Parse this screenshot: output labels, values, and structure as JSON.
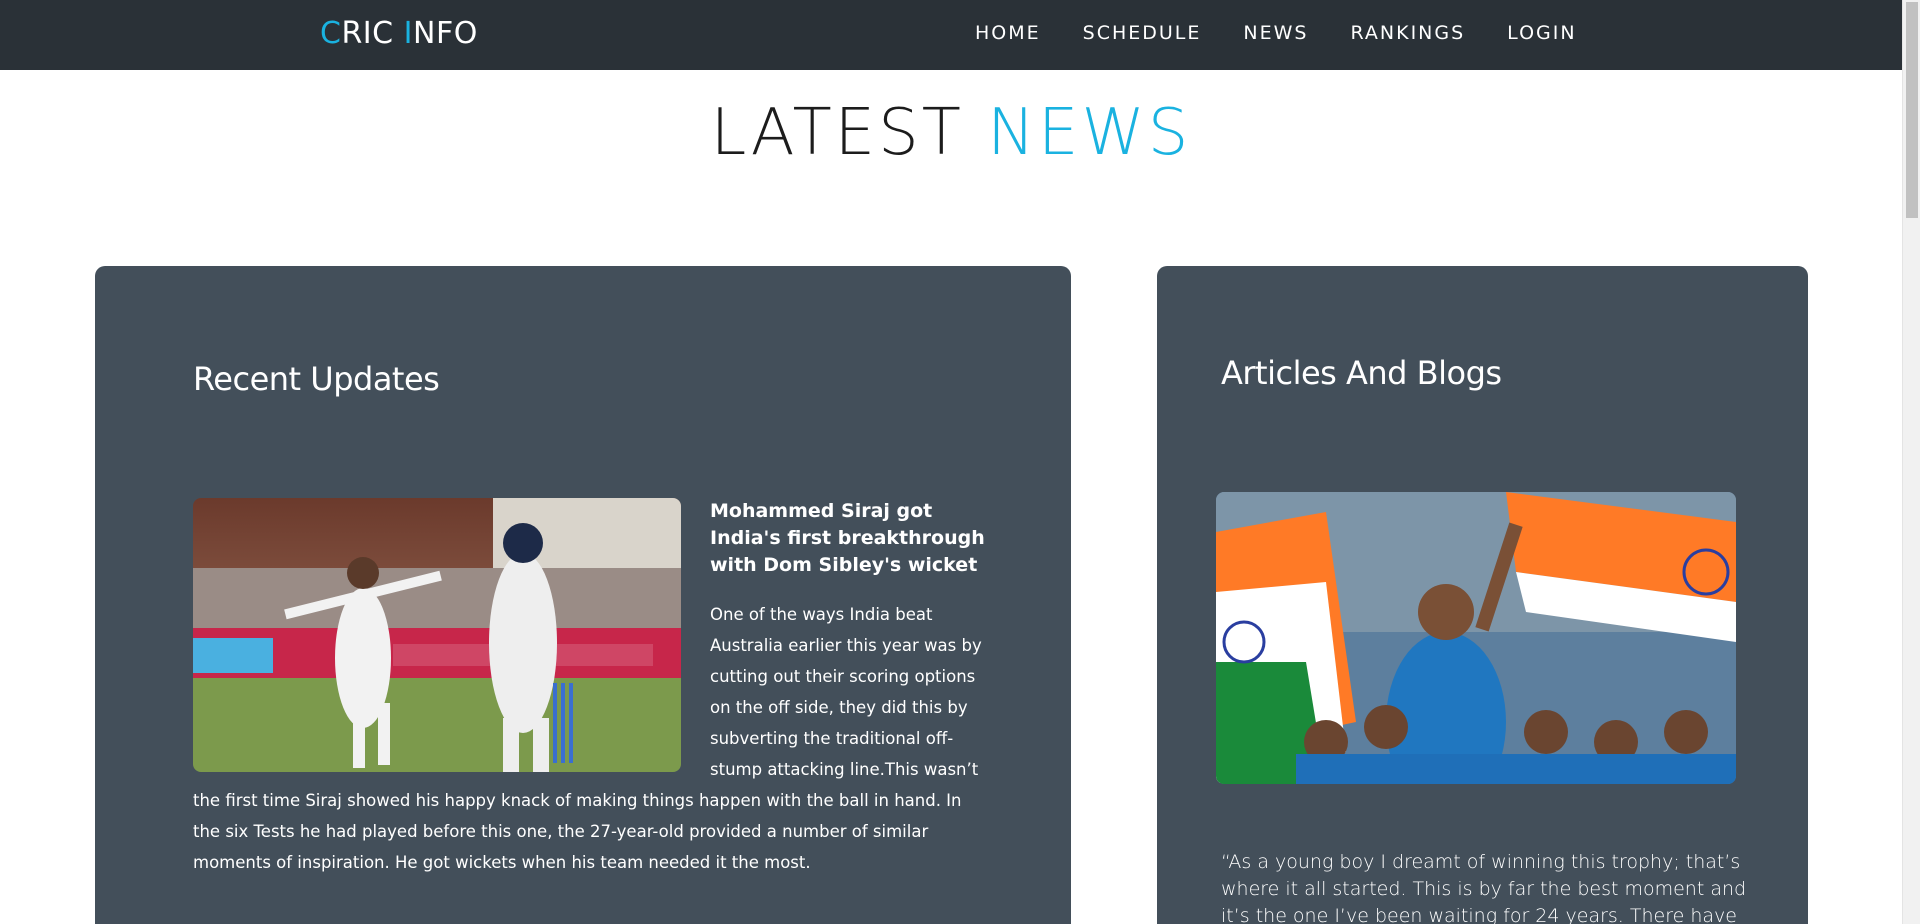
{
  "brand": {
    "first_letter": "C",
    "first_rest": "RIC ",
    "second_letter": "I",
    "second_rest": "NFO"
  },
  "nav": {
    "items": [
      {
        "label": "HOME"
      },
      {
        "label": "SCHEDULE"
      },
      {
        "label": "NEWS"
      },
      {
        "label": "RANKINGS"
      },
      {
        "label": "LOGIN"
      }
    ]
  },
  "page": {
    "title_main": "LATEST ",
    "title_accent": "NEWS"
  },
  "recent": {
    "heading": "Recent Updates",
    "news_title": "Mohammed Siraj got India's first breakthrough with Dom Sibley's wicket",
    "news_body": "One of the ways India beat Australia earlier this year was by cutting out their scoring options on the off side, they did this by subverting the traditional off-stump attacking line.This wasn’t the first time Siraj showed his happy knack of making things happen with the ball in hand. In the six Tests he had played before this one, the 27-year-old provided a number of similar moments of inspiration. He got wickets when his team needed it the most."
  },
  "articles": {
    "heading": "Articles And Blogs",
    "quote": "“As a young boy I dreamt of winning this trophy; that’s where it all started. This is by far the best moment and it’s the one I’ve been waiting for 24 years. There have"
  },
  "colors": {
    "navbar": "#2a3137",
    "accent": "#1ab2e0",
    "card": "#434f5a"
  }
}
